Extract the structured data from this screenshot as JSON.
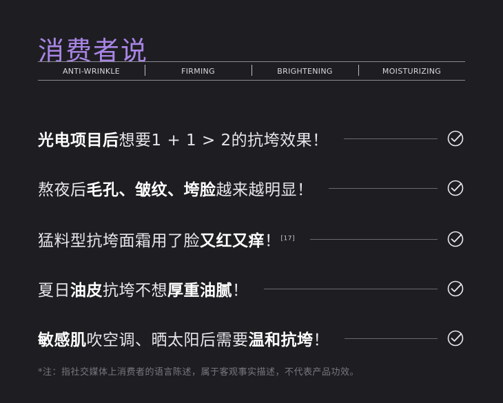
{
  "title": "消费者说",
  "tags": [
    "ANTI-WRINKLE",
    "FIRMING",
    "BRIGHTENING",
    "MOISTURIZING"
  ],
  "rows": [
    {
      "b1": "光电项目后",
      "t1": "想要1 + 1 > 2的抗垮效果！",
      "b2": "",
      "t2": "",
      "b3": "",
      "t3": "",
      "sup": ""
    },
    {
      "b1": "",
      "t1": "熬夜后",
      "b2": "毛孔、皱纹、垮脸",
      "t2": "越来越明显！",
      "b3": "",
      "t3": "",
      "sup": ""
    },
    {
      "b1": "",
      "t1": "猛料型抗垮面霜用了脸",
      "b2": "又红又痒",
      "t2": "！",
      "b3": "",
      "t3": "",
      "sup": "[17]"
    },
    {
      "b1": "",
      "t1": "夏日",
      "b2": "油皮",
      "t2": "抗垮不想",
      "b3": "厚重油腻",
      "t3": "！",
      "sup": ""
    },
    {
      "b1": "敏感肌",
      "t1": "吹空调、晒太阳后需要",
      "b2": "温和抗垮",
      "t2": "！",
      "b3": "",
      "t3": "",
      "sup": ""
    }
  ],
  "check_icon": "check-circle-icon",
  "note": "*注：指社交媒体上消费者的语言陈述，属于客观事实描述，不代表产品功效。",
  "colors": {
    "title": "#a985e6",
    "background": "#1e1e22",
    "text": "#e6e6ea"
  }
}
